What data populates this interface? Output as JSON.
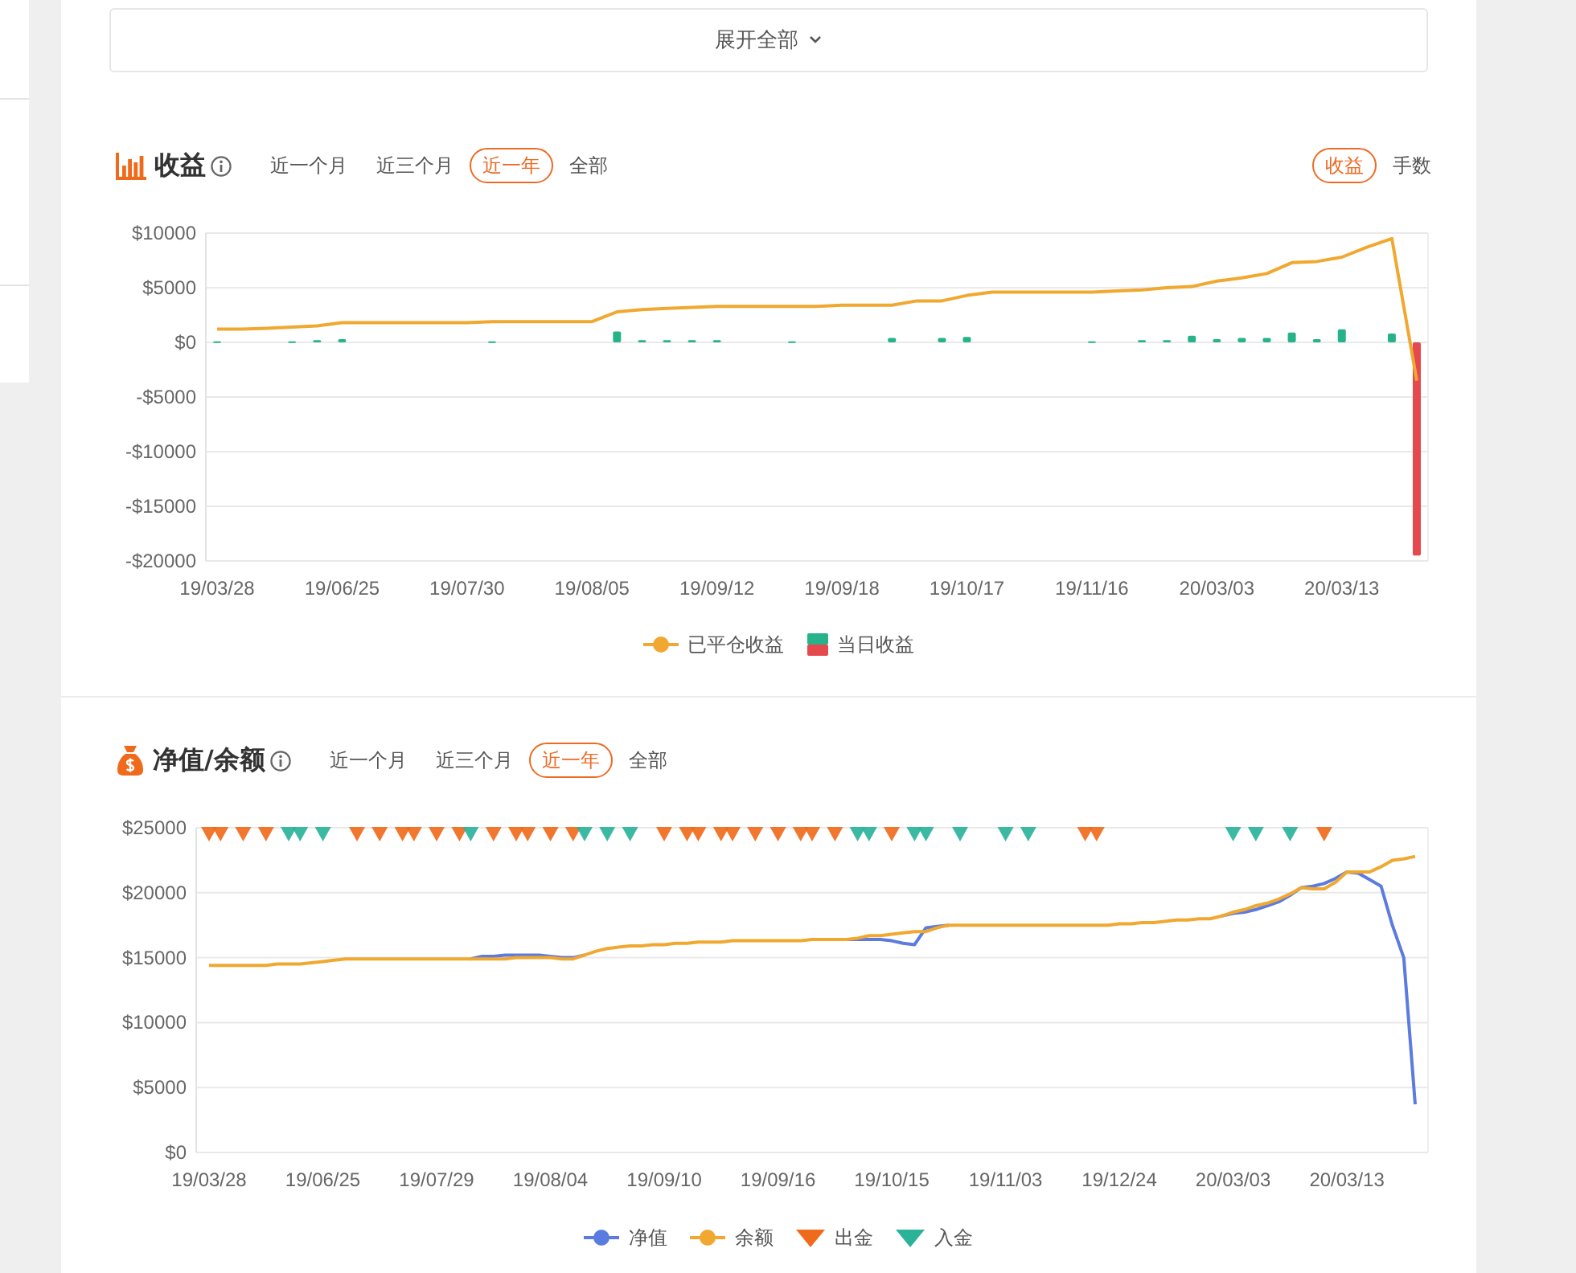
{
  "expand_button": {
    "label": "展开全部"
  },
  "sections": [
    {
      "title": "收益",
      "tabs": [
        {
          "label": "近一个月",
          "selected": false
        },
        {
          "label": "近三个月",
          "selected": false
        },
        {
          "label": "近一年",
          "selected": true
        },
        {
          "label": "全部",
          "selected": false
        }
      ],
      "modes": [
        {
          "label": "收益",
          "selected": true
        },
        {
          "label": "手数",
          "selected": false
        }
      ],
      "chart_data": {
        "type": "line",
        "grid": true,
        "ylim": [
          -20000,
          10000
        ],
        "yticks": [
          {
            "value": 10000,
            "label": "$10000"
          },
          {
            "value": 5000,
            "label": "$5000"
          },
          {
            "value": 0,
            "label": "$0"
          },
          {
            "value": -5000,
            "label": "-$5000"
          },
          {
            "value": -10000,
            "label": "-$10000"
          },
          {
            "value": -15000,
            "label": "-$15000"
          },
          {
            "value": -20000,
            "label": "-$20000"
          }
        ],
        "categories": [
          "19/03/28",
          null,
          null,
          null,
          null,
          "19/06/25",
          null,
          null,
          null,
          null,
          "19/07/30",
          null,
          null,
          null,
          null,
          "19/08/05",
          null,
          null,
          null,
          null,
          "19/09/12",
          null,
          null,
          null,
          null,
          "19/09/18",
          null,
          null,
          null,
          null,
          "19/10/17",
          null,
          null,
          null,
          null,
          "19/11/16",
          null,
          null,
          null,
          null,
          "20/03/03",
          null,
          null,
          null,
          null,
          "20/03/13",
          null,
          null,
          null
        ],
        "series": [
          {
            "name": "已平仓收益",
            "color": "#f0a830",
            "values": [
              1200,
              1200,
              1300,
              1400,
              1500,
              1800,
              1800,
              1800,
              1800,
              1800,
              1800,
              1900,
              1900,
              1900,
              1900,
              1900,
              2800,
              3000,
              3100,
              3200,
              3300,
              3300,
              3300,
              3300,
              3300,
              3400,
              3400,
              3400,
              3800,
              3800,
              4300,
              4600,
              4600,
              4600,
              4600,
              4600,
              4700,
              4800,
              5000,
              5100,
              5600,
              5900,
              6300,
              7300,
              7400,
              7800,
              8700,
              9500,
              -3500
            ]
          },
          {
            "name": "当日收益",
            "type": "bar",
            "color": "#27b38a",
            "values": [
              100,
              null,
              null,
              100,
              200,
              300,
              null,
              null,
              null,
              null,
              null,
              100,
              null,
              null,
              null,
              null,
              1000,
              200,
              200,
              200,
              200,
              null,
              null,
              100,
              null,
              null,
              null,
              400,
              null,
              400,
              500,
              null,
              null,
              null,
              null,
              100,
              null,
              200,
              200,
              600,
              300,
              400,
              400,
              900,
              300,
              1200,
              null,
              800,
              null
            ]
          },
          {
            "type": "bar",
            "color": "#e5484d",
            "values": [
              null,
              null,
              null,
              null,
              null,
              null,
              null,
              null,
              null,
              null,
              null,
              null,
              null,
              null,
              null,
              null,
              null,
              null,
              null,
              null,
              null,
              null,
              null,
              null,
              null,
              null,
              null,
              null,
              null,
              null,
              null,
              null,
              null,
              null,
              null,
              null,
              null,
              null,
              null,
              null,
              null,
              null,
              null,
              null,
              null,
              null,
              null,
              null,
              -19500
            ]
          }
        ]
      }
    },
    {
      "title": "净值/余额",
      "tabs": [
        {
          "label": "近一个月",
          "selected": false
        },
        {
          "label": "近三个月",
          "selected": false
        },
        {
          "label": "近一年",
          "selected": true
        },
        {
          "label": "全部",
          "selected": false
        }
      ],
      "chart_data": {
        "type": "line",
        "grid": true,
        "ylim": [
          0,
          25000
        ],
        "yticks": [
          {
            "value": 25000,
            "label": "$25000"
          },
          {
            "value": 20000,
            "label": "$20000"
          },
          {
            "value": 15000,
            "label": "$15000"
          },
          {
            "value": 10000,
            "label": "$10000"
          },
          {
            "value": 5000,
            "label": "$5000"
          },
          {
            "value": 0,
            "label": "$0"
          }
        ],
        "categories": [
          "19/03/28",
          null,
          null,
          null,
          null,
          null,
          null,
          null,
          null,
          null,
          "19/06/25",
          null,
          null,
          null,
          null,
          null,
          null,
          null,
          null,
          null,
          "19/07/29",
          null,
          null,
          null,
          null,
          null,
          null,
          null,
          null,
          null,
          "19/08/04",
          null,
          null,
          null,
          null,
          null,
          null,
          null,
          null,
          null,
          "19/09/10",
          null,
          null,
          null,
          null,
          null,
          null,
          null,
          null,
          null,
          "19/09/16",
          null,
          null,
          null,
          null,
          null,
          null,
          null,
          null,
          null,
          "19/10/15",
          null,
          null,
          null,
          null,
          null,
          null,
          null,
          null,
          null,
          "19/11/03",
          null,
          null,
          null,
          null,
          null,
          null,
          null,
          null,
          null,
          "19/12/24",
          null,
          null,
          null,
          null,
          null,
          null,
          null,
          null,
          null,
          "20/03/03",
          null,
          null,
          null,
          null,
          null,
          null,
          null,
          null,
          null,
          "20/03/13",
          null,
          null,
          null,
          null,
          null,
          null
        ],
        "series": [
          {
            "name": "净值",
            "color": "#5b7be0",
            "values": [
              null,
              null,
              null,
              null,
              null,
              null,
              null,
              null,
              null,
              null,
              null,
              null,
              null,
              null,
              null,
              null,
              null,
              null,
              null,
              null,
              null,
              null,
              null,
              14900,
              15100,
              15100,
              15200,
              15200,
              15200,
              15200,
              15100,
              15000,
              15000,
              15200,
              null,
              null,
              null,
              null,
              null,
              null,
              null,
              null,
              null,
              null,
              null,
              null,
              null,
              null,
              null,
              null,
              null,
              null,
              null,
              null,
              null,
              null,
              16400,
              16400,
              16400,
              16400,
              16300,
              16100,
              16000,
              17300,
              17400,
              17500,
              null,
              null,
              null,
              null,
              null,
              null,
              null,
              null,
              null,
              null,
              null,
              null,
              null,
              null,
              null,
              null,
              null,
              null,
              null,
              null,
              null,
              null,
              null,
              18200,
              18400,
              18500,
              18700,
              19000,
              19300,
              19800,
              20400,
              20500,
              20700,
              21100,
              21600,
              21500,
              21000,
              20500,
              17500,
              15000,
              3700
            ]
          },
          {
            "name": "余额",
            "color": "#f0a830",
            "values": [
              14400,
              14400,
              14400,
              14400,
              14400,
              14400,
              14500,
              14500,
              14500,
              14600,
              14700,
              14800,
              14900,
              14900,
              14900,
              14900,
              14900,
              14900,
              14900,
              14900,
              14900,
              14900,
              14900,
              14900,
              14900,
              14900,
              14900,
              15000,
              15000,
              15000,
              15000,
              14900,
              14900,
              15200,
              15500,
              15700,
              15800,
              15900,
              15900,
              16000,
              16000,
              16100,
              16100,
              16200,
              16200,
              16200,
              16300,
              16300,
              16300,
              16300,
              16300,
              16300,
              16300,
              16400,
              16400,
              16400,
              16400,
              16500,
              16700,
              16700,
              16800,
              16900,
              17000,
              17000,
              17300,
              17500,
              17500,
              17500,
              17500,
              17500,
              17500,
              17500,
              17500,
              17500,
              17500,
              17500,
              17500,
              17500,
              17500,
              17500,
              17600,
              17600,
              17700,
              17700,
              17800,
              17900,
              17900,
              18000,
              18000,
              18200,
              18500,
              18700,
              19000,
              19200,
              19500,
              19900,
              20400,
              20300,
              20300,
              20800,
              21600,
              21600,
              21600,
              22000,
              22500,
              22600,
              22800
            ]
          },
          {
            "name": "出金",
            "type": "scatter",
            "color": "#f06a1c",
            "values": [
              24500,
              24500,
              null,
              24500,
              null,
              24500,
              null,
              null,
              null,
              null,
              null,
              null,
              null,
              24500,
              null,
              24500,
              null,
              24500,
              24500,
              null,
              24500,
              null,
              24500,
              null,
              null,
              24500,
              null,
              24500,
              24500,
              null,
              24500,
              null,
              24500,
              null,
              null,
              null,
              null,
              null,
              null,
              null,
              24500,
              null,
              24500,
              24500,
              null,
              24500,
              24500,
              null,
              24500,
              null,
              24500,
              null,
              24500,
              24500,
              null,
              24500,
              null,
              null,
              null,
              null,
              24500,
              null,
              null,
              null,
              null,
              null,
              null,
              null,
              null,
              null,
              null,
              null,
              null,
              null,
              null,
              null,
              null,
              24500,
              24500,
              null,
              null,
              null,
              null,
              null,
              null,
              null,
              null,
              null,
              null,
              null,
              null,
              null,
              null,
              null,
              null,
              null,
              null,
              null,
              24500,
              null,
              null,
              null,
              null,
              null,
              null,
              null,
              null
            ]
          },
          {
            "name": "入金",
            "type": "scatter",
            "color": "#2bb39a",
            "values": [
              null,
              null,
              null,
              null,
              null,
              null,
              null,
              24500,
              24500,
              null,
              24500,
              null,
              null,
              null,
              null,
              null,
              null,
              null,
              null,
              null,
              null,
              null,
              null,
              24500,
              null,
              null,
              null,
              null,
              null,
              null,
              null,
              null,
              null,
              24500,
              null,
              24500,
              null,
              24500,
              null,
              null,
              null,
              null,
              null,
              null,
              null,
              null,
              null,
              null,
              null,
              null,
              null,
              null,
              null,
              null,
              null,
              null,
              null,
              24500,
              24500,
              null,
              null,
              null,
              24500,
              24500,
              null,
              null,
              24500,
              null,
              null,
              null,
              24500,
              null,
              24500,
              null,
              null,
              null,
              null,
              null,
              null,
              null,
              null,
              null,
              null,
              null,
              null,
              null,
              null,
              null,
              null,
              null,
              24500,
              null,
              24500,
              null,
              null,
              24500,
              null,
              null,
              null,
              null,
              null,
              null,
              null,
              null,
              null,
              null,
              null
            ]
          }
        ]
      }
    }
  ]
}
